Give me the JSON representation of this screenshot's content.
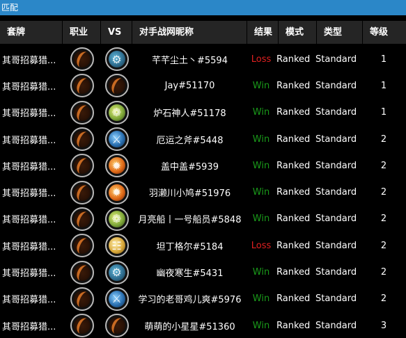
{
  "window": {
    "title": "匹配"
  },
  "columns": [
    "套牌",
    "职业",
    "VS",
    "对手战网昵称",
    "结果",
    "模式",
    "类型",
    "等级"
  ],
  "colors": {
    "win": "#1a9a1a",
    "loss": "#e02020",
    "titlebar": "#2b87c8"
  },
  "rows": [
    {
      "deck": "其哥招募猎...",
      "class_icon": "hunter-class-icon",
      "opponent_icon": "mech-class-icon",
      "opponent": "芊芊尘土丶#5594",
      "result": "Loss",
      "mode": "Ranked",
      "type": "Standard",
      "level": "1"
    },
    {
      "deck": "其哥招募猎...",
      "class_icon": "hunter-class-icon",
      "opponent_icon": "hunter-class-icon",
      "opponent": "Jay#51170",
      "result": "Win",
      "mode": "Ranked",
      "type": "Standard",
      "level": "1"
    },
    {
      "deck": "其哥招募猎...",
      "class_icon": "hunter-class-icon",
      "opponent_icon": "nature-class-icon",
      "opponent": "炉石神人#51178",
      "result": "Win",
      "mode": "Ranked",
      "type": "Standard",
      "level": "1"
    },
    {
      "deck": "其哥招募猎...",
      "class_icon": "hunter-class-icon",
      "opponent_icon": "sword-class-icon",
      "opponent": "厄运之斧#5448",
      "result": "Win",
      "mode": "Ranked",
      "type": "Standard",
      "level": "2"
    },
    {
      "deck": "其哥招募猎...",
      "class_icon": "hunter-class-icon",
      "opponent_icon": "fire-class-icon",
      "opponent": "盖中盖#5939",
      "result": "Win",
      "mode": "Ranked",
      "type": "Standard",
      "level": "2"
    },
    {
      "deck": "其哥招募猎...",
      "class_icon": "hunter-class-icon",
      "opponent_icon": "fire-class-icon",
      "opponent": "羽濑川小鸠#51976",
      "result": "Win",
      "mode": "Ranked",
      "type": "Standard",
      "level": "2"
    },
    {
      "deck": "其哥招募猎...",
      "class_icon": "hunter-class-icon",
      "opponent_icon": "nature-class-icon",
      "opponent": "月亮船丨一号船员#5848",
      "result": "Win",
      "mode": "Ranked",
      "type": "Standard",
      "level": "2"
    },
    {
      "deck": "其哥招募猎...",
      "class_icon": "hunter-class-icon",
      "opponent_icon": "scroll-class-icon",
      "opponent": "坦丁格尔#5184",
      "result": "Loss",
      "mode": "Ranked",
      "type": "Standard",
      "level": "2"
    },
    {
      "deck": "其哥招募猎...",
      "class_icon": "hunter-class-icon",
      "opponent_icon": "mech-class-icon",
      "opponent": "幽夜寒生#5431",
      "result": "Win",
      "mode": "Ranked",
      "type": "Standard",
      "level": "2"
    },
    {
      "deck": "其哥招募猎...",
      "class_icon": "hunter-class-icon",
      "opponent_icon": "sword-class-icon",
      "opponent": "学习的老哥鸡儿爽#5976",
      "result": "Win",
      "mode": "Ranked",
      "type": "Standard",
      "level": "2"
    },
    {
      "deck": "其哥招募猎...",
      "class_icon": "hunter-class-icon",
      "opponent_icon": "hunter-class-icon",
      "opponent": "萌萌的小星星#51360",
      "result": "Win",
      "mode": "Ranked",
      "type": "Standard",
      "level": "3"
    }
  ]
}
